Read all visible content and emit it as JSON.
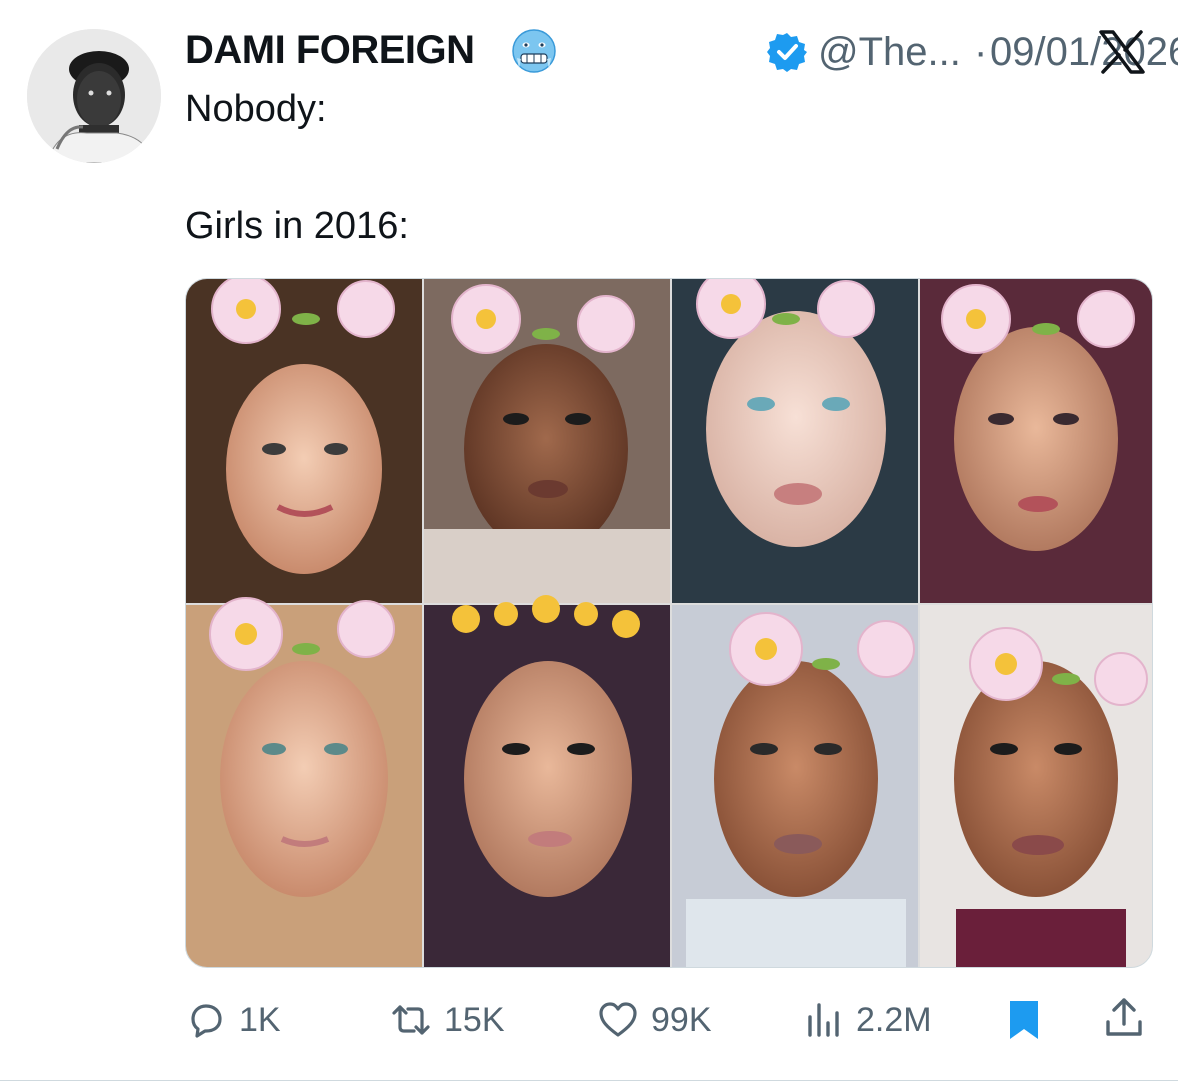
{
  "author": {
    "name": "DAMI FOREIGN",
    "handle": "@The...",
    "separator": "·",
    "date": "09/01/2026",
    "emoji": "cold-face-emoji",
    "verified": "verified-badge"
  },
  "tweet": {
    "line1": "Nobody:",
    "line2": "Girls in 2016:"
  },
  "media": {
    "description_icon": "image-grid",
    "tiles": 8
  },
  "actions": {
    "replies": "1K",
    "reposts": "15K",
    "likes": "99K",
    "views": "2.2M"
  },
  "colors": {
    "accent": "#1d9bf0",
    "muted": "#536471",
    "text": "#0f1419"
  }
}
